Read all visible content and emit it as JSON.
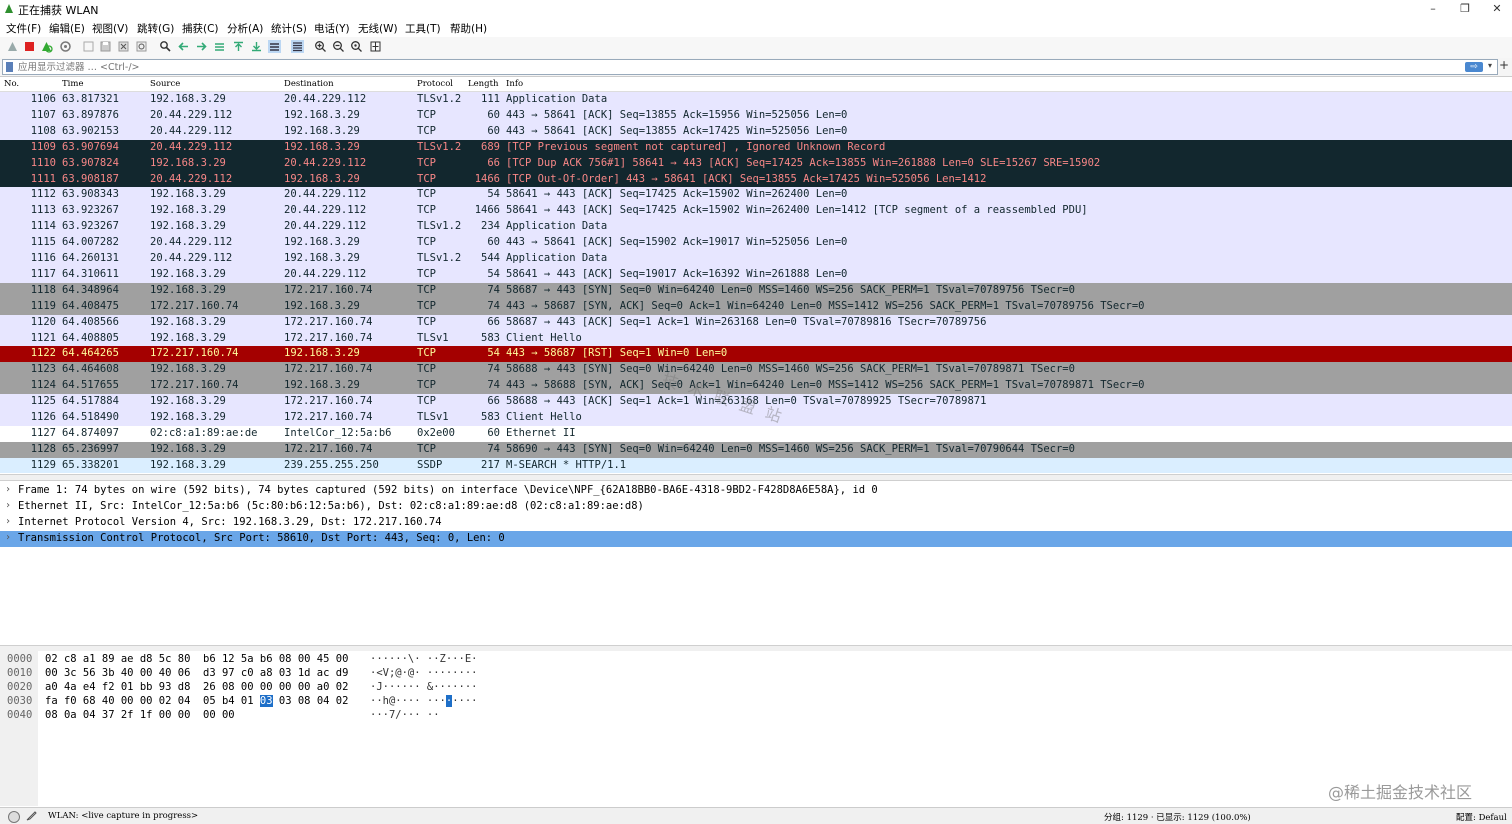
{
  "window": {
    "title": "正在捕获 WLAN",
    "minimize": "–",
    "restore": "❐",
    "close": "✕"
  },
  "menu": [
    "文件(F)",
    "编辑(E)",
    "视图(V)",
    "跳转(G)",
    "捕获(C)",
    "分析(A)",
    "统计(S)",
    "电话(Y)",
    "无线(W)",
    "工具(T)",
    "帮助(H)"
  ],
  "filter": {
    "placeholder": "应用显示过滤器 … <Ctrl-/>",
    "apply_label": "⇨",
    "dropdown_label": "▾",
    "add_label": "+"
  },
  "columns": {
    "no": "No.",
    "time": "Time",
    "source": "Source",
    "destination": "Destination",
    "protocol": "Protocol",
    "length": "Length",
    "info": "Info"
  },
  "packets": [
    {
      "no": "1106",
      "time": "63.817321",
      "src": "192.168.3.29",
      "dst": "20.44.229.112",
      "proto": "TLSv1.2",
      "len": "111",
      "info": "Application Data",
      "style": "tls"
    },
    {
      "no": "1107",
      "time": "63.897876",
      "src": "20.44.229.112",
      "dst": "192.168.3.29",
      "proto": "TCP",
      "len": "60",
      "info": "443 → 58641 [ACK] Seq=13855 Ack=15956 Win=525056 Len=0",
      "style": "tcp"
    },
    {
      "no": "1108",
      "time": "63.902153",
      "src": "20.44.229.112",
      "dst": "192.168.3.29",
      "proto": "TCP",
      "len": "60",
      "info": "443 → 58641 [ACK] Seq=13855 Ack=17425 Win=525056 Len=0",
      "style": "tcp"
    },
    {
      "no": "1109",
      "time": "63.907694",
      "src": "20.44.229.112",
      "dst": "192.168.3.29",
      "proto": "TLSv1.2",
      "len": "689",
      "info": "[TCP Previous segment not captured] , Ignored Unknown Record",
      "style": "bad"
    },
    {
      "no": "1110",
      "time": "63.907824",
      "src": "192.168.3.29",
      "dst": "20.44.229.112",
      "proto": "TCP",
      "len": "66",
      "info": "[TCP Dup ACK 756#1] 58641 → 443 [ACK] Seq=17425 Ack=13855 Win=261888 Len=0 SLE=15267 SRE=15902",
      "style": "bad"
    },
    {
      "no": "1111",
      "time": "63.908187",
      "src": "20.44.229.112",
      "dst": "192.168.3.29",
      "proto": "TCP",
      "len": "1466",
      "info": "[TCP Out-Of-Order] 443 → 58641 [ACK] Seq=13855 Ack=17425 Win=525056 Len=1412",
      "style": "bad"
    },
    {
      "no": "1112",
      "time": "63.908343",
      "src": "192.168.3.29",
      "dst": "20.44.229.112",
      "proto": "TCP",
      "len": "54",
      "info": "58641 → 443 [ACK] Seq=17425 Ack=15902 Win=262400 Len=0",
      "style": "tcp"
    },
    {
      "no": "1113",
      "time": "63.923267",
      "src": "192.168.3.29",
      "dst": "20.44.229.112",
      "proto": "TCP",
      "len": "1466",
      "info": "58641 → 443 [ACK] Seq=17425 Ack=15902 Win=262400 Len=1412 [TCP segment of a reassembled PDU]",
      "style": "tcp"
    },
    {
      "no": "1114",
      "time": "63.923267",
      "src": "192.168.3.29",
      "dst": "20.44.229.112",
      "proto": "TLSv1.2",
      "len": "234",
      "info": "Application Data",
      "style": "tls"
    },
    {
      "no": "1115",
      "time": "64.007282",
      "src": "20.44.229.112",
      "dst": "192.168.3.29",
      "proto": "TCP",
      "len": "60",
      "info": "443 → 58641 [ACK] Seq=15902 Ack=19017 Win=525056 Len=0",
      "style": "tcp"
    },
    {
      "no": "1116",
      "time": "64.260131",
      "src": "20.44.229.112",
      "dst": "192.168.3.29",
      "proto": "TLSv1.2",
      "len": "544",
      "info": "Application Data",
      "style": "tls"
    },
    {
      "no": "1117",
      "time": "64.310611",
      "src": "192.168.3.29",
      "dst": "20.44.229.112",
      "proto": "TCP",
      "len": "54",
      "info": "58641 → 443 [ACK] Seq=19017 Ack=16392 Win=261888 Len=0",
      "style": "tcp"
    },
    {
      "no": "1118",
      "time": "64.348964",
      "src": "192.168.3.29",
      "dst": "172.217.160.74",
      "proto": "TCP",
      "len": "74",
      "info": "58687 → 443 [SYN] Seq=0 Win=64240 Len=0 MSS=1460 WS=256 SACK_PERM=1 TSval=70789756 TSecr=0",
      "style": "syn"
    },
    {
      "no": "1119",
      "time": "64.408475",
      "src": "172.217.160.74",
      "dst": "192.168.3.29",
      "proto": "TCP",
      "len": "74",
      "info": "443 → 58687 [SYN, ACK] Seq=0 Ack=1 Win=64240 Len=0 MSS=1412 WS=256 SACK_PERM=1 TSval=70789756 TSecr=0",
      "style": "syn"
    },
    {
      "no": "1120",
      "time": "64.408566",
      "src": "192.168.3.29",
      "dst": "172.217.160.74",
      "proto": "TCP",
      "len": "66",
      "info": "58687 → 443 [ACK] Seq=1 Ack=1 Win=263168 Len=0 TSval=70789816 TSecr=70789756",
      "style": "tcp"
    },
    {
      "no": "1121",
      "time": "64.408805",
      "src": "192.168.3.29",
      "dst": "172.217.160.74",
      "proto": "TLSv1",
      "len": "583",
      "info": "Client Hello",
      "style": "tls"
    },
    {
      "no": "1122",
      "time": "64.464265",
      "src": "172.217.160.74",
      "dst": "192.168.3.29",
      "proto": "TCP",
      "len": "54",
      "info": "443 → 58687 [RST] Seq=1 Win=0 Len=0",
      "style": "rst"
    },
    {
      "no": "1123",
      "time": "64.464608",
      "src": "192.168.3.29",
      "dst": "172.217.160.74",
      "proto": "TCP",
      "len": "74",
      "info": "58688 → 443 [SYN] Seq=0 Win=64240 Len=0 MSS=1460 WS=256 SACK_PERM=1 TSval=70789871 TSecr=0",
      "style": "syn"
    },
    {
      "no": "1124",
      "time": "64.517655",
      "src": "172.217.160.74",
      "dst": "192.168.3.29",
      "proto": "TCP",
      "len": "74",
      "info": "443 → 58688 [SYN, ACK] Seq=0 Ack=1 Win=64240 Len=0 MSS=1412 WS=256 SACK_PERM=1 TSval=70789871 TSecr=0",
      "style": "syn"
    },
    {
      "no": "1125",
      "time": "64.517884",
      "src": "192.168.3.29",
      "dst": "172.217.160.74",
      "proto": "TCP",
      "len": "66",
      "info": "58688 → 443 [ACK] Seq=1 Ack=1 Win=263168 Len=0 TSval=70789925 TSecr=70789871",
      "style": "tcp"
    },
    {
      "no": "1126",
      "time": "64.518490",
      "src": "192.168.3.29",
      "dst": "172.217.160.74",
      "proto": "TLSv1",
      "len": "583",
      "info": "Client Hello",
      "style": "tls"
    },
    {
      "no": "1127",
      "time": "64.874097",
      "src": "02:c8:a1:89:ae:de",
      "dst": "IntelCor_12:5a:b6",
      "proto": "0x2e00",
      "len": "60",
      "info": "Ethernet II",
      "style": "eth"
    },
    {
      "no": "1128",
      "time": "65.236997",
      "src": "192.168.3.29",
      "dst": "172.217.160.74",
      "proto": "TCP",
      "len": "74",
      "info": "58690 → 443 [SYN] Seq=0 Win=64240 Len=0 MSS=1460 WS=256 SACK_PERM=1 TSval=70790644 TSecr=0",
      "style": "syn"
    },
    {
      "no": "1129",
      "time": "65.338201",
      "src": "192.168.3.29",
      "dst": "239.255.255.250",
      "proto": "SSDP",
      "len": "217",
      "info": "M-SEARCH * HTTP/1.1",
      "style": "udp"
    }
  ],
  "watermark": "技 术 联 盟 站",
  "details": [
    {
      "text": "Frame 1: 74 bytes on wire (592 bits), 74 bytes captured (592 bits) on interface \\Device\\NPF_{62A18BB0-BA6E-4318-9BD2-F428D8A6E58A}, id 0",
      "selected": false
    },
    {
      "text": "Ethernet II, Src: IntelCor_12:5a:b6 (5c:80:b6:12:5a:b6), Dst: 02:c8:a1:89:ae:d8 (02:c8:a1:89:ae:d8)",
      "selected": false
    },
    {
      "text": "Internet Protocol Version 4, Src: 192.168.3.29, Dst: 172.217.160.74",
      "selected": false
    },
    {
      "text": "Transmission Control Protocol, Src Port: 58610, Dst Port: 443, Seq: 0, Len: 0",
      "selected": true
    }
  ],
  "detail_arrow": "›",
  "bytes": [
    {
      "off": "0000",
      "hex1": "02 c8 a1 89 ae d8 5c 80",
      "hex2": "b6 12 5a b6 08 00 45 00",
      "ascii": "······\\· ··Z···E·"
    },
    {
      "off": "0010",
      "hex1": "00 3c 56 3b 40 00 40 06",
      "hex2": "d3 97 c0 a8 03 1d ac d9",
      "ascii": "·<V;@·@· ········"
    },
    {
      "off": "0020",
      "hex1": "a0 4a e4 f2 01 bb 93 d8",
      "hex2": "26 08 00 00 00 00 a0 02",
      "ascii": "·J······ &·······"
    },
    {
      "off": "0030",
      "hex1": "fa f0 68 40 00 00 02 04",
      "hex2_pre": "05 b4 01 ",
      "hex2_hl": "03",
      "hex2_post": " 03 08 04 02",
      "ascii_pre": "··h@···· ···",
      "ascii_hl": "·",
      "ascii_post": "····"
    },
    {
      "off": "0040",
      "hex1": "08 0a 04 37 2f 1f 00 00",
      "hex2": "00 00",
      "ascii": "···7/··· ··"
    }
  ],
  "corner_watermark": "@稀土掘金技术社区",
  "status": {
    "capture": "WLAN: <live capture in progress>",
    "packets": "分组: 1129 · 已显示: 1129 (100.0%)",
    "profile": "配置: Defaul"
  }
}
